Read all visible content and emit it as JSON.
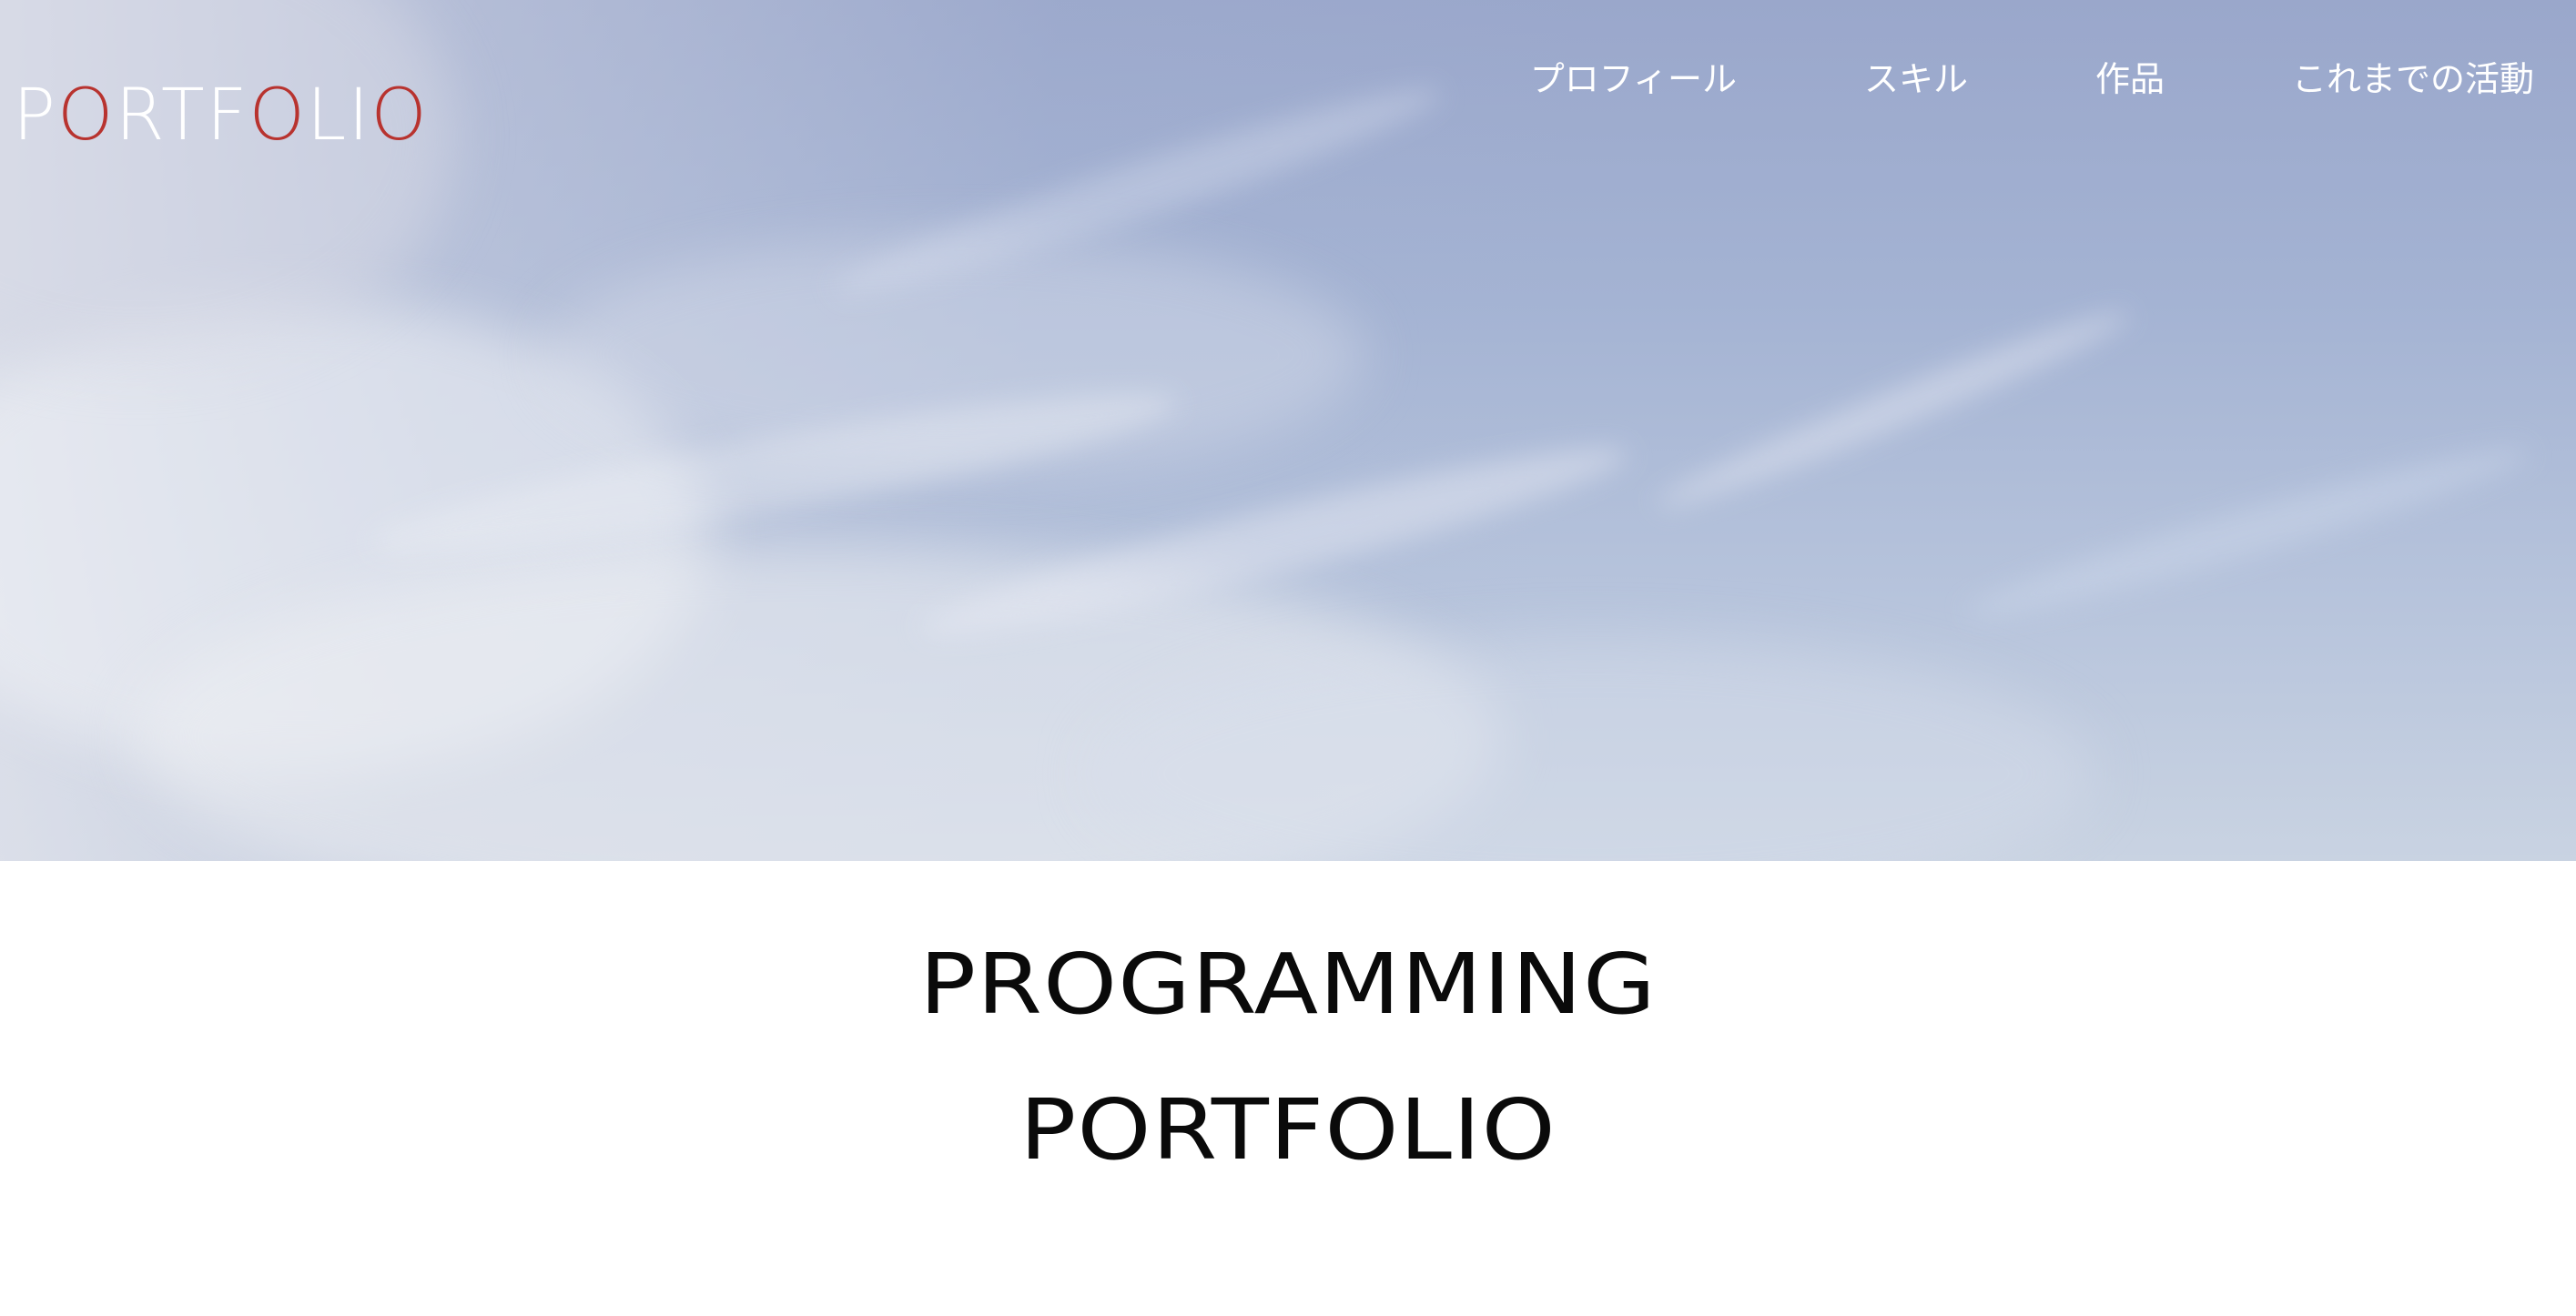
{
  "logo": {
    "letters": [
      {
        "ch": "P",
        "accent": false
      },
      {
        "ch": "O",
        "accent": true
      },
      {
        "ch": "R",
        "accent": false
      },
      {
        "ch": "T",
        "accent": false
      },
      {
        "ch": "F",
        "accent": false
      },
      {
        "ch": "O",
        "accent": true
      },
      {
        "ch": "L",
        "accent": false
      },
      {
        "ch": "I",
        "accent": false
      },
      {
        "ch": "O",
        "accent": true
      }
    ],
    "accent_color": "#b8332f",
    "base_color": "#ffffff"
  },
  "nav": {
    "items": [
      {
        "label": "プロフィール"
      },
      {
        "label": "スキル"
      },
      {
        "label": "作品"
      },
      {
        "label": "これまでの活動"
      }
    ]
  },
  "hero": {
    "image": "sky-with-clouds"
  },
  "title": {
    "line1": "PROGRAMMING",
    "line2": "PORTFOLIO"
  }
}
